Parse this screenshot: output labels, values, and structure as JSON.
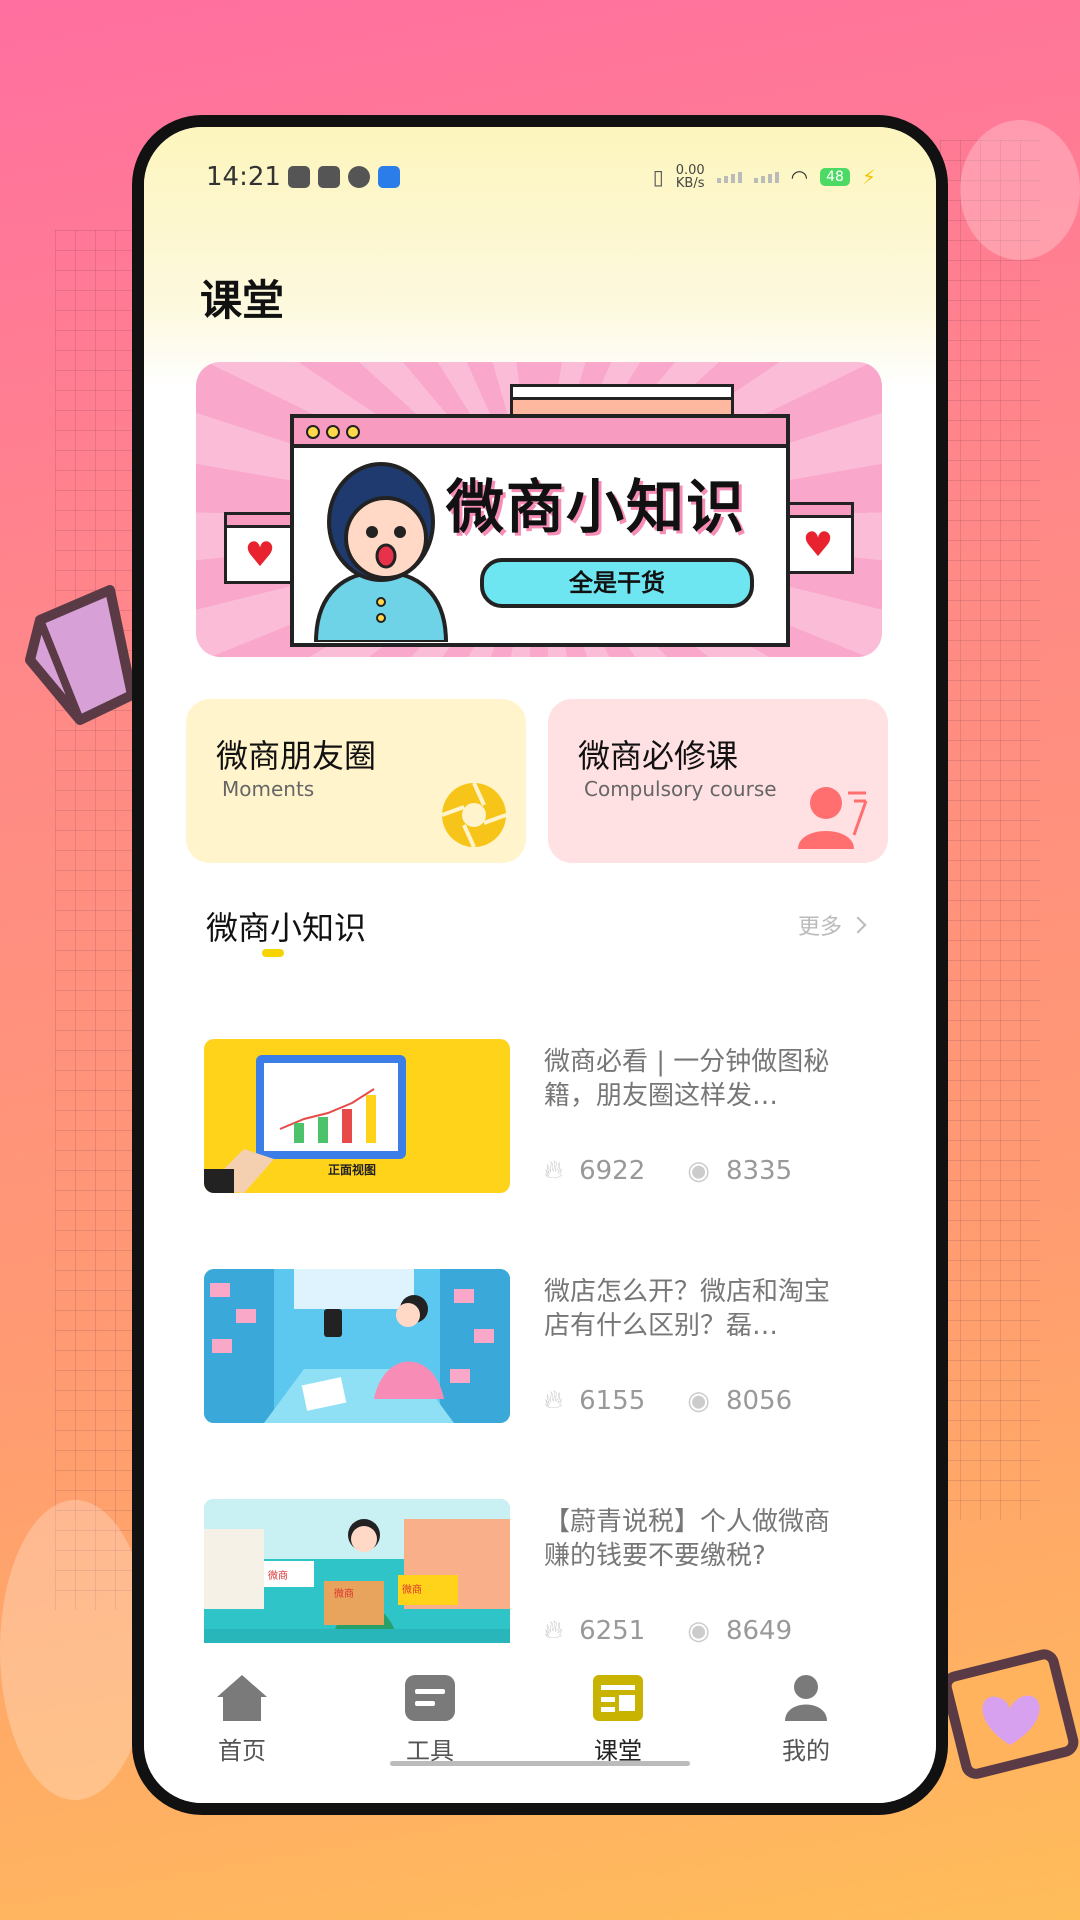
{
  "status_bar": {
    "time": "14:21",
    "net_speed_value": "0.00",
    "net_speed_unit": "KB/s",
    "battery": "48"
  },
  "page": {
    "title": "课堂"
  },
  "banner": {
    "title": "微商小知识",
    "button_label": "全是干货"
  },
  "cards": [
    {
      "title": "微商朋友圈",
      "subtitle": "Moments",
      "icon": "aperture-icon",
      "color": "#fff4cc"
    },
    {
      "title": "微商必修课",
      "subtitle": "Compulsory course",
      "icon": "person-icon",
      "color": "#ffe0e3"
    }
  ],
  "section": {
    "title": "微商小知识",
    "more_label": "更多"
  },
  "articles": [
    {
      "title": "微商必看 | 一分钟做图秘籍，朋友圈这样发…",
      "likes": "6922",
      "views": "8335",
      "thumb_caption": "正面视图"
    },
    {
      "title": "微店怎么开？微店和淘宝店有什么区别？磊…",
      "likes": "6155",
      "views": "8056"
    },
    {
      "title": "【蔚青说税】个人做微商赚的钱要不要缴税?",
      "likes": "6251",
      "views": "8649",
      "thumb_signs": [
        "微商",
        "微商",
        "微商"
      ]
    }
  ],
  "tabbar": {
    "items": [
      {
        "label": "首页",
        "icon": "home-icon"
      },
      {
        "label": "工具",
        "icon": "tools-icon"
      },
      {
        "label": "课堂",
        "icon": "classroom-icon",
        "active": true
      },
      {
        "label": "我的",
        "icon": "profile-icon"
      }
    ],
    "active_color": "#c7b300",
    "inactive_color": "#7a7a7a"
  }
}
